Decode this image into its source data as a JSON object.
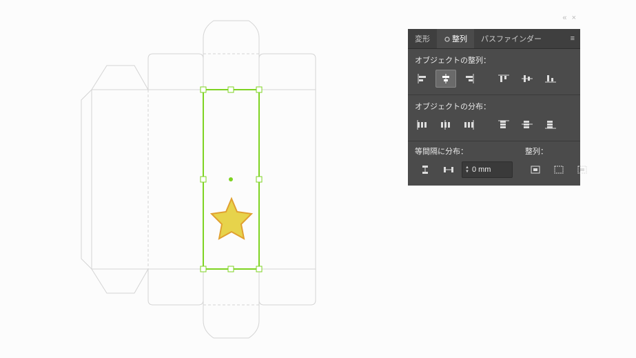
{
  "tabs": {
    "transform": "変形",
    "align": "整列",
    "pathfinder": "パスファインダー"
  },
  "sections": {
    "align_objects": "オブジェクトの整列：",
    "distribute_objects": "オブジェクトの分布：",
    "distribute_spacing": "等間隔に分布：",
    "align_to": "整列："
  },
  "spacing_value": "0 mm",
  "icons": {
    "align_left": "align-left-icon",
    "align_hcenter": "align-hcenter-icon",
    "align_right": "align-right-icon",
    "align_top": "align-top-icon",
    "align_vcenter": "align-vcenter-icon",
    "align_bottom": "align-bottom-icon",
    "dist_left": "distribute-left-icon",
    "dist_hcenter": "distribute-hcenter-icon",
    "dist_right": "distribute-right-icon",
    "dist_top": "distribute-top-icon",
    "dist_vcenter": "distribute-vcenter-icon",
    "dist_bottom": "distribute-bottom-icon",
    "space_v": "space-vertical-icon",
    "space_h": "space-horizontal-icon",
    "align_artboard": "align-to-artboard-icon",
    "align_selection": "align-to-selection-icon",
    "align_key": "align-to-key-icon"
  },
  "colors": {
    "panel_bg": "#4b4b4b",
    "accent": "#7ed321",
    "star_fill": "#e7d34b"
  }
}
